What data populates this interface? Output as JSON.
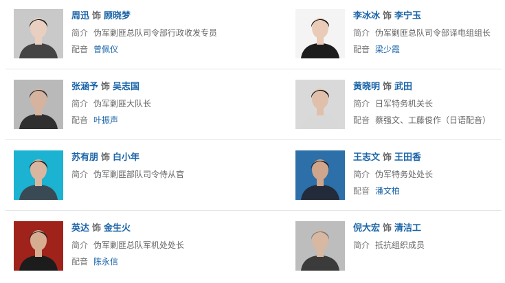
{
  "cast": [
    {
      "actor": "周迅",
      "sep": "饰",
      "role": "顾晓梦",
      "intro_label": "简介",
      "intro": "伪军剿匪总队司令部行政收发专员",
      "dub_label": "配音",
      "dub": "曾佩仪",
      "photo": {
        "bg": "#c9c9c9",
        "skin": "#e8cfc0",
        "hair": "#1a1a1a",
        "cloth": "#444444"
      }
    },
    {
      "actor": "李冰冰",
      "sep": "饰",
      "role": "李宁玉",
      "intro_label": "简介",
      "intro": "伪军剿匪总队司令部译电组组长",
      "dub_label": "配音",
      "dub": "梁少霞",
      "photo": {
        "bg": "#f4f4f4",
        "skin": "#e9cbb8",
        "hair": "#111111",
        "cloth": "#1c1c1c"
      }
    },
    {
      "actor": "张涵予",
      "sep": "饰",
      "role": "吴志国",
      "intro_label": "简介",
      "intro": "伪军剿匪大队长",
      "dub_label": "配音",
      "dub": "叶振声",
      "photo": {
        "bg": "#b9b9b9",
        "skin": "#d6b39e",
        "hair": "#2a2a2a",
        "cloth": "#2f2f2f"
      }
    },
    {
      "actor": "黄晓明",
      "sep": "饰",
      "role": "武田",
      "intro_label": "简介",
      "intro": "日军特务机关长",
      "dub_label": "配音",
      "dub": "蔡强文、工藤俊作（日语配音）",
      "photo": {
        "bg": "#d9d9d9",
        "skin": "#e0c0aa",
        "hair": "#151515",
        "cloth": "#d8d8d8"
      }
    },
    {
      "actor": "苏有朋",
      "sep": "饰",
      "role": "白小年",
      "intro_label": "简介",
      "intro": "伪军剿匪部队司令侍从官",
      "dub_label": "",
      "dub": "",
      "photo": {
        "bg": "#1bb3d1",
        "skin": "#d9b69f",
        "hair": "#1a1a1a",
        "cloth": "#3a4a55"
      }
    },
    {
      "actor": "王志文",
      "sep": "饰",
      "role": "王田香",
      "intro_label": "简介",
      "intro": "伪军特务处处长",
      "dub_label": "配音",
      "dub": "潘文柏",
      "photo": {
        "bg": "#2d6fa8",
        "skin": "#cfa58c",
        "hair": "#1e1e1e",
        "cloth": "#232a3a"
      }
    },
    {
      "actor": "英达",
      "sep": "饰",
      "role": "金生火",
      "intro_label": "简介",
      "intro": "伪军剿匪总队军机处处长",
      "dub_label": "配音",
      "dub": "陈永信",
      "photo": {
        "bg": "#a0231b",
        "skin": "#d7ad92",
        "hair": "#222222",
        "cloth": "#1c1c1c"
      }
    },
    {
      "actor": "倪大宏",
      "sep": "饰",
      "role": "清洁工",
      "intro_label": "简介",
      "intro": "抵抗组织成员",
      "dub_label": "",
      "dub": "",
      "photo": {
        "bg": "#bdbdbd",
        "skin": "#d8b8a0",
        "hair": "#7a7a7a",
        "cloth": "#3b3b3b"
      }
    }
  ]
}
